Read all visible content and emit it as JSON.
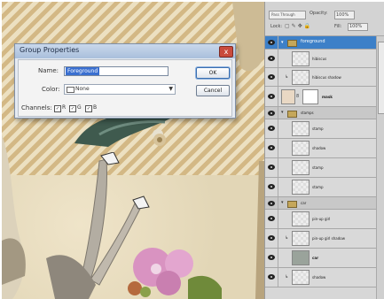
{
  "dialog": {
    "title": "Group Properties",
    "close_glyph": "x",
    "name_label": "Name:",
    "name_value": "Foreground",
    "color_label": "Color:",
    "color_value": "None",
    "channels_label": "Channels:",
    "channels": [
      {
        "label": "R",
        "checked": true
      },
      {
        "label": "G",
        "checked": true
      },
      {
        "label": "B",
        "checked": true
      }
    ],
    "ok_label": "OK",
    "cancel_label": "Cancel"
  },
  "layers_panel": {
    "blend_mode": "Pass Through",
    "opacity_label": "Opacity:",
    "opacity_value": "100%",
    "lock_label": "Lock:",
    "fill_label": "Fill:",
    "fill_value": "100%",
    "layers": [
      {
        "name": "foreground",
        "kind": "group",
        "selected": true
      },
      {
        "name": "hibiscus",
        "kind": "layer"
      },
      {
        "name": "hibiscus shadow",
        "kind": "layer"
      },
      {
        "name": "mask",
        "kind": "layer"
      },
      {
        "name": "stamps",
        "kind": "group"
      },
      {
        "name": "stamp",
        "kind": "layer"
      },
      {
        "name": "shadow",
        "kind": "layer"
      },
      {
        "name": "stamp",
        "kind": "layer"
      },
      {
        "name": "stamp",
        "kind": "layer"
      },
      {
        "name": "car",
        "kind": "group"
      },
      {
        "name": "pin-up girl",
        "kind": "layer"
      },
      {
        "name": "pin-up girl shadow",
        "kind": "layer"
      },
      {
        "name": "car",
        "kind": "layer"
      },
      {
        "name": "shadow",
        "kind": "layer"
      }
    ]
  }
}
